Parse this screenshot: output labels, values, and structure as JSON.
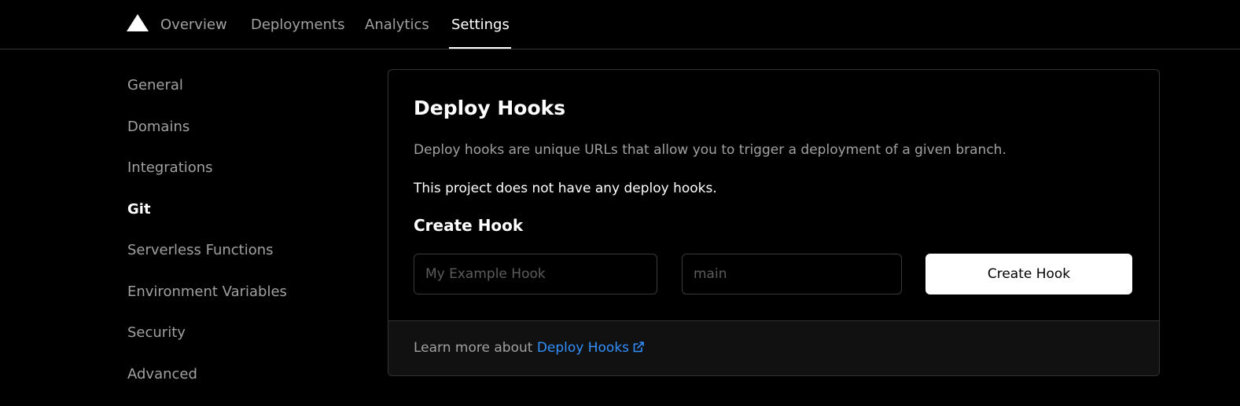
{
  "topnav": {
    "logo_icon": "triangle-logo-icon",
    "tabs": [
      {
        "label": "Overview"
      },
      {
        "label": "Deployments"
      },
      {
        "label": "Analytics"
      },
      {
        "label": "Settings",
        "active": true
      }
    ]
  },
  "sidebar": {
    "items": [
      {
        "label": "General"
      },
      {
        "label": "Domains"
      },
      {
        "label": "Integrations"
      },
      {
        "label": "Git",
        "active": true
      },
      {
        "label": "Serverless Functions"
      },
      {
        "label": "Environment Variables"
      },
      {
        "label": "Security"
      },
      {
        "label": "Advanced"
      }
    ]
  },
  "card": {
    "title": "Deploy Hooks",
    "description": "Deploy hooks are unique URLs that allow you to trigger a deployment of a given branch.",
    "empty_message": "This project does not have any deploy hooks.",
    "create_title": "Create Hook",
    "name_input": {
      "value": "",
      "placeholder": "My Example Hook"
    },
    "branch_input": {
      "value": "",
      "placeholder": "main"
    },
    "create_button_label": "Create Hook",
    "footer": {
      "prefix": "Learn more about ",
      "link_label": "Deploy Hooks",
      "link_icon": "external-link-icon"
    }
  },
  "colors": {
    "background": "#000000",
    "link": "#3291ff",
    "muted_text": "#a1a1a1",
    "border": "#333333"
  }
}
